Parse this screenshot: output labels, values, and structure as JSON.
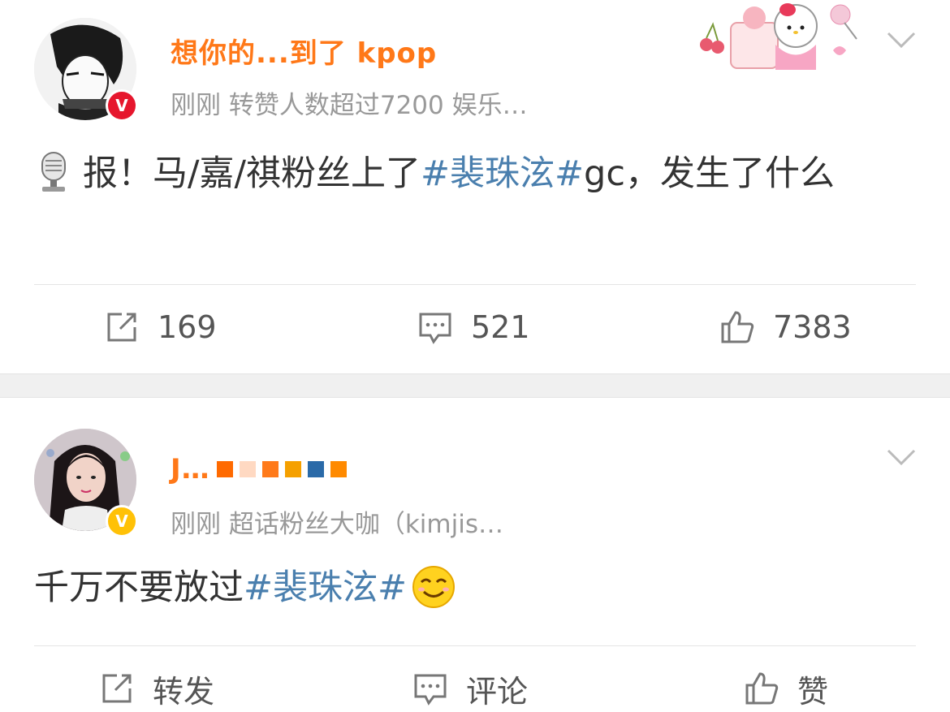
{
  "posts": [
    {
      "username": "想你的...到了 kpop",
      "meta": "刚刚  转赞人数超过7200  娱乐…",
      "content_before": "报！马/嘉/祺粉丝上了",
      "topic": "#裴珠泫#",
      "content_after": "gc，发生了什么",
      "repost": "169",
      "comment": "521",
      "like": "7383",
      "verify_badge": "V"
    },
    {
      "username": "J…",
      "meta": "刚刚  超话粉丝大咖（kimjis…",
      "content_before": "千万不要放过",
      "topic": "#裴珠泫#",
      "content_after": "",
      "repost": "转发",
      "comment": "评论",
      "like": "赞",
      "verify_badge": "V"
    }
  ],
  "colors": {
    "topic": "#4a7fae",
    "orange_vip": "#ff6a00",
    "badge_red": "#e6162d",
    "badge_yellow": "#ffc107",
    "separator": "#f0f0f0"
  },
  "icons": {
    "repost": "repost-icon",
    "comment": "comment-icon",
    "like": "thumbs-up-icon",
    "more": "chevron-down-icon"
  }
}
